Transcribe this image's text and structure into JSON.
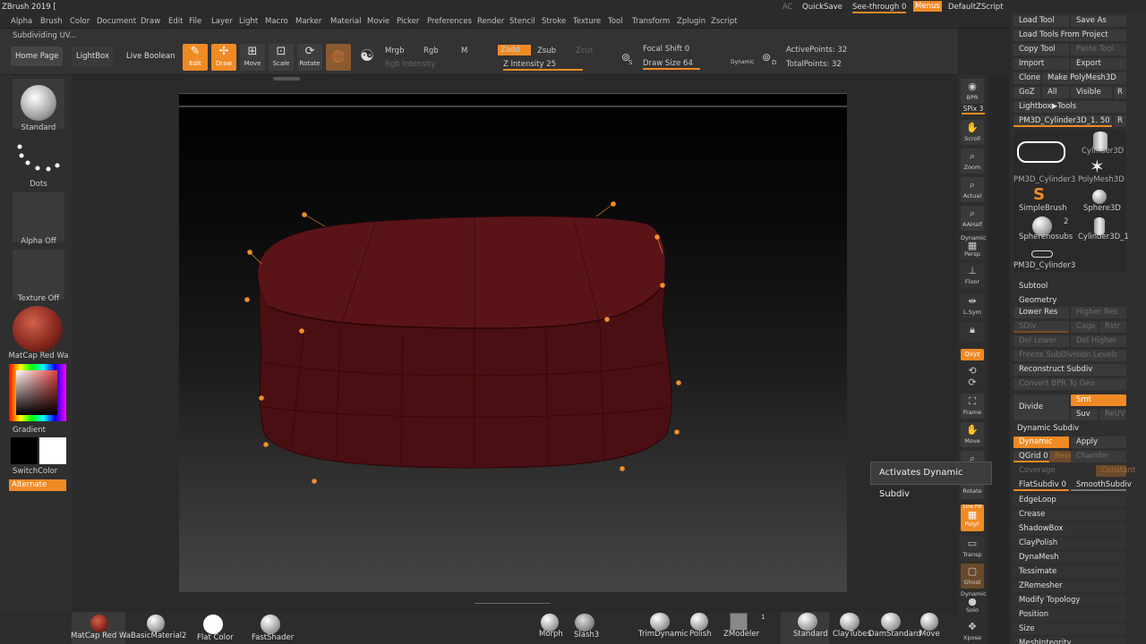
{
  "app": {
    "title": "ZBrush 2019 [",
    "status": "Subdividing UV..."
  },
  "menus": [
    "Alpha",
    "Brush",
    "Color",
    "Document",
    "Draw",
    "Edit",
    "File",
    "Layer",
    "Light",
    "Macro",
    "Marker",
    "Material",
    "Movie",
    "Picker",
    "Preferences",
    "Render",
    "Stencil",
    "Stroke",
    "Texture",
    "Tool",
    "Transform",
    "Zplugin",
    "Zscript"
  ],
  "topright": {
    "ac": "AC",
    "quicksave": "QuickSave",
    "seethrough": "See-through 0",
    "menus": "Menus",
    "script": "DefaultZScript"
  },
  "shelf": {
    "home": "Home Page",
    "lightbox": "LightBox",
    "liveboolean": "Live Boolean",
    "edit": "Edit",
    "draw": "Draw",
    "move": "Move",
    "scale": "Scale",
    "rotate": "Rotate",
    "mrgb": "Mrgb",
    "rgb": "Rgb",
    "m": "M",
    "rgbintensity": "Rgb Intensity",
    "zadd": "Zadd",
    "zsub": "Zsub",
    "zcut": "Zcut",
    "zintensity": "Z Intensity 25",
    "focalshift": "Focal Shift 0",
    "drawsize": "Draw Size 64",
    "dynamic": "Dynamic",
    "activepoints": "ActivePoints: 32",
    "totalpoints": "TotalPoints: 32",
    "s_label": "S",
    "d_label": "D"
  },
  "left": {
    "standard": "Standard",
    "dots": "Dots",
    "alphaoff": "Alpha Off",
    "textureoff": "Texture Off",
    "matcap": "MatCap Red Wa",
    "gradient": "Gradient",
    "switchcolor": "SwitchColor",
    "alternate": "Alternate"
  },
  "bottom": {
    "matcap": "MatCap Red Wa",
    "basicmat": "BasicMaterial2",
    "flatcolor": "Flat Color",
    "fastshader": "FastShader",
    "morph": "Morph",
    "slash": "Slash3",
    "trimdynamic": "TrimDynamic",
    "polish": "Polish",
    "zmodeler": "ZModeler",
    "zmodeler_count": "1",
    "standard": "Standard",
    "claytubes": "ClayTubes",
    "damstandard": "DamStandard",
    "move": "Move"
  },
  "vtool": {
    "bpr": "BPR",
    "spix": "SPix 3",
    "scroll": "Scroll",
    "zoom": "Zoom",
    "actual": "Actual",
    "aahalf": "AAHalf",
    "dynamic": "Dynamic",
    "persp": "Persp",
    "floor": "Floor",
    "lsym": "L.Sym",
    "lock": "",
    "xyz": "Qxyz",
    "frame": "Frame",
    "move": "Move",
    "zoom3d": "",
    "rotate": "Rotate",
    "linefill": "Line Fill",
    "polyf": "PolyF",
    "transp": "Transp",
    "ghost": "Ghost",
    "solo": "Solo",
    "dynamic2": "Dynamic",
    "xpose": "Xpose"
  },
  "tool": {
    "loadtool": "Load Tool",
    "saveas": "Save As",
    "loadfromproject": "Load Tools From Project",
    "copytool": "Copy Tool",
    "pastetool": "Paste Tool",
    "import": "Import",
    "export": "Export",
    "clone": "Clone",
    "makepolymesh": "Make PolyMesh3D",
    "goz": "GoZ",
    "all": "All",
    "visible": "Visible",
    "r": "R",
    "lightbox": "Lightbox▶Tools",
    "current": "PM3D_Cylinder3D_1. 50",
    "r2": "R",
    "thumbs": [
      {
        "label": "PM3D_Cylinder3"
      },
      {
        "label": "Cylinder3D"
      },
      {
        "label": "PolyMesh3D"
      },
      {
        "label": "SimpleBrush"
      },
      {
        "label": "Sphere3D"
      },
      {
        "label": "Spherenosubs"
      },
      {
        "label": "Cylinder3D_1"
      },
      {
        "label": "PM3D_Cylinder3"
      }
    ],
    "spherecount": "2"
  },
  "subtool": {
    "title": "Subtool",
    "geometry": "Geometry",
    "lowerres": "Lower Res",
    "higherres": "Higher Res",
    "sdiv": "SDiv",
    "cage": "Cage",
    "rstr": "Rstr",
    "dellower": "Del Lower",
    "delhigher": "Del Higher",
    "freeze": "Freeze SubDivision Levels",
    "reconstruct": "Reconstruct Subdiv",
    "convertbpr": "Convert BPR To Geo",
    "divide": "Divide",
    "smt": "Smt",
    "suv": "Suv",
    "reuv": "ReUV",
    "dynsubdiv": "Dynamic Subdiv",
    "dynamic": "Dynamic",
    "apply": "Apply",
    "qgrid": "QGrid 0",
    "bevel": "Bevel",
    "chamfer": "Chamfer",
    "coverage": "Coverage",
    "constant": "Constant",
    "flatsubdiv": "FlatSubdiv 0",
    "smoothsubdiv": "SmoothSubdiv",
    "edgeloop": "EdgeLoop",
    "crease": "Crease",
    "shadowbox": "ShadowBox",
    "claypolish": "ClayPolish",
    "dynamesh": "DynaMesh",
    "tessimate": "Tessimate",
    "zremesher": "ZRemesher",
    "modifytopology": "Modify Topology",
    "position": "Position",
    "size": "Size",
    "meshintegrity": "MeshIntegrity"
  },
  "tooltip": "Activates Dynamic Subdiv",
  "colors": {
    "accent": "#f08a24",
    "mesh": "#5a1216"
  }
}
